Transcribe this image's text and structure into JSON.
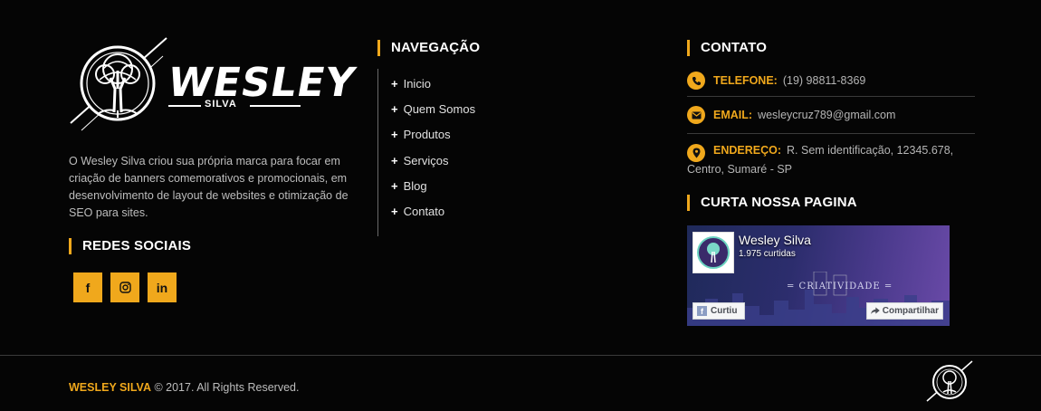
{
  "brand": {
    "logo_word": "WESLEY",
    "logo_sub": "SILVA",
    "about": "O Wesley Silva criou sua própria marca para focar em criação de banners comemorativos e promocionais, em desenvolvimento de layout de websites e otimização de SEO para sites."
  },
  "social": {
    "heading": "REDES SOCIAIS",
    "items": [
      {
        "icon": "facebook-icon",
        "glyph": "f"
      },
      {
        "icon": "instagram-icon",
        "glyph": ""
      },
      {
        "icon": "linkedin-icon",
        "glyph": "in"
      }
    ]
  },
  "nav": {
    "heading": "NAVEGAÇÃO",
    "plus": "+",
    "items": [
      "Inicio",
      "Quem Somos",
      "Produtos",
      "Serviços",
      "Blog",
      "Contato"
    ]
  },
  "contact": {
    "heading": "CONTATO",
    "phone_label": "TELEFONE:",
    "phone": "(19) 98811-8369",
    "email_label": "EMAIL:",
    "email": "wesleycruz789@gmail.com",
    "address_label": "ENDEREÇO:",
    "address": "R. Sem identificação, 12345.678, Centro, Sumaré - SP"
  },
  "facebook": {
    "heading": "CURTA NOSSA PAGINA",
    "page_name": "Wesley Silva",
    "likes": "1.975 curtidas",
    "cover_text": "= CRIATIVIDADE =",
    "like_button": "Curtiu",
    "share_button": "Compartilhar"
  },
  "footer": {
    "brand": "WESLEY SILVA",
    "rights": " © 2017. All Rights Reserved."
  },
  "colors": {
    "accent": "#f0a81c",
    "background": "#050505"
  }
}
